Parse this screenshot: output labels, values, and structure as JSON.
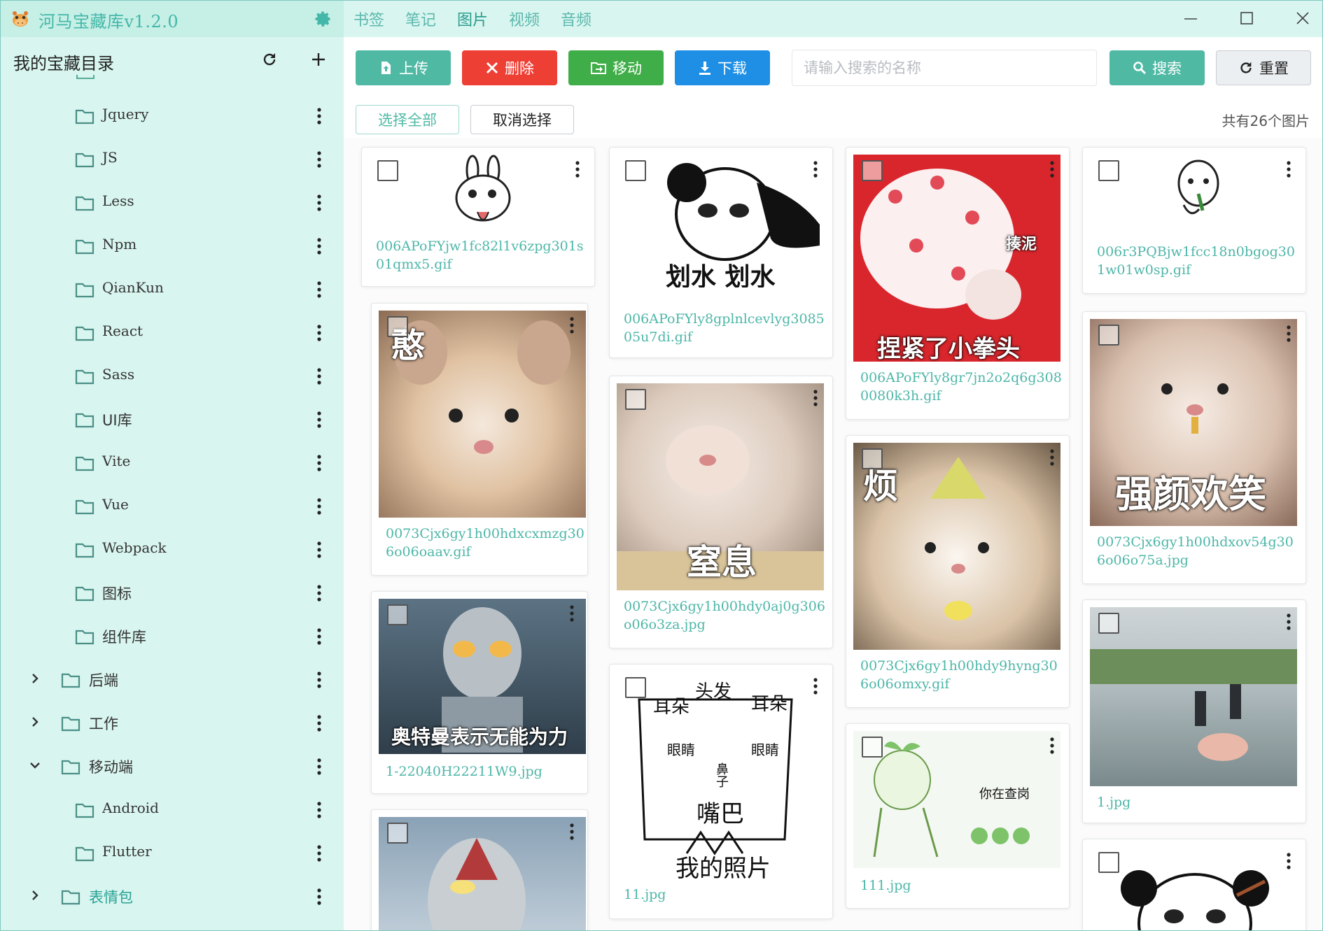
{
  "app": {
    "title": "河马宝藏库v1.2.0"
  },
  "sidebar": {
    "header": "我的宝藏目录",
    "items": [
      {
        "label": "Jquery",
        "kind": "folder",
        "level": 2
      },
      {
        "label": "JS",
        "kind": "folder",
        "level": 2
      },
      {
        "label": "Less",
        "kind": "folder",
        "level": 2
      },
      {
        "label": "Npm",
        "kind": "folder",
        "level": 2
      },
      {
        "label": "QianKun",
        "kind": "folder",
        "level": 2
      },
      {
        "label": "React",
        "kind": "folder",
        "level": 2
      },
      {
        "label": "Sass",
        "kind": "folder",
        "level": 2
      },
      {
        "label": "UI库",
        "kind": "folder",
        "level": 2
      },
      {
        "label": "Vite",
        "kind": "folder",
        "level": 2
      },
      {
        "label": "Vue",
        "kind": "folder",
        "level": 2
      },
      {
        "label": "Webpack",
        "kind": "folder",
        "level": 2
      },
      {
        "label": "图标",
        "kind": "folder",
        "level": 2
      },
      {
        "label": "组件库",
        "kind": "folder",
        "level": 2
      },
      {
        "label": "后端",
        "kind": "folder",
        "level": 1,
        "state": "collapsed"
      },
      {
        "label": "工作",
        "kind": "folder",
        "level": 1,
        "state": "collapsed"
      },
      {
        "label": "移动端",
        "kind": "folder",
        "level": 1,
        "state": "expanded"
      },
      {
        "label": "Android",
        "kind": "folder",
        "level": 2
      },
      {
        "label": "Flutter",
        "kind": "folder",
        "level": 2
      },
      {
        "label": "表情包",
        "kind": "folder",
        "level": 1,
        "state": "collapsed",
        "active": true
      }
    ]
  },
  "tabs": [
    {
      "label": "书签"
    },
    {
      "label": "笔记"
    },
    {
      "label": "图片",
      "active": true
    },
    {
      "label": "视频"
    },
    {
      "label": "音频"
    }
  ],
  "toolbar": {
    "upload": "上传",
    "delete": "删除",
    "move": "移动",
    "download": "下载",
    "search_placeholder": "请输入搜索的名称",
    "search": "搜索",
    "reset": "重置",
    "select_all": "选择全部",
    "deselect": "取消选择",
    "count_text": "共有26个图片"
  },
  "images": [
    {
      "filename": "006APoFYjw1fc82l1v6zpg301s01qmx5.gif",
      "caption": ""
    },
    {
      "filename": "006APoFYly8gplnlcevlyg308505u7di.gif",
      "caption": "划水 划水"
    },
    {
      "filename": "006APoFYly8gr7jn2o2q6g3080080k3h.gif",
      "caption": "揍泥",
      "caption2": "捏紧了小拳头"
    },
    {
      "filename": "006r3PQBjw1fcc18n0bgog301w01w0sp.gif",
      "caption": ""
    },
    {
      "filename": "0073Cjx6gy1h00hdxcxmzg306o06oaav.gif",
      "caption": "憨"
    },
    {
      "filename": "0073Cjx6gy1h00hdy0aj0g306o06o3za.jpg",
      "caption": "窒息"
    },
    {
      "filename": "0073Cjx6gy1h00hdy9hyng306o06omxy.gif",
      "caption": "烦"
    },
    {
      "filename": "0073Cjx6gy1h00hdxov54g306o06o75a.jpg",
      "caption": "强颜欢笑"
    },
    {
      "filename": "1-22040H22211W9.jpg",
      "caption": "奥特曼表示无能为力"
    },
    {
      "filename": "11.jpg",
      "caption": "我的照片",
      "labels": [
        "头发",
        "耳朵",
        "耳朵",
        "眼睛",
        "眼睛",
        "鼻子",
        "嘴巴"
      ]
    },
    {
      "filename": "111.jpg",
      "caption": "你在查岗"
    },
    {
      "filename": "1.jpg",
      "caption": ""
    },
    {
      "filename": "",
      "caption": ""
    },
    {
      "filename": "",
      "caption": ""
    }
  ],
  "colors": {
    "accent": "#4fb9a4",
    "sidebar_bg": "#d8f5ef",
    "danger": "#ee3f35",
    "success": "#3fae48",
    "primary": "#1e8fe5"
  }
}
